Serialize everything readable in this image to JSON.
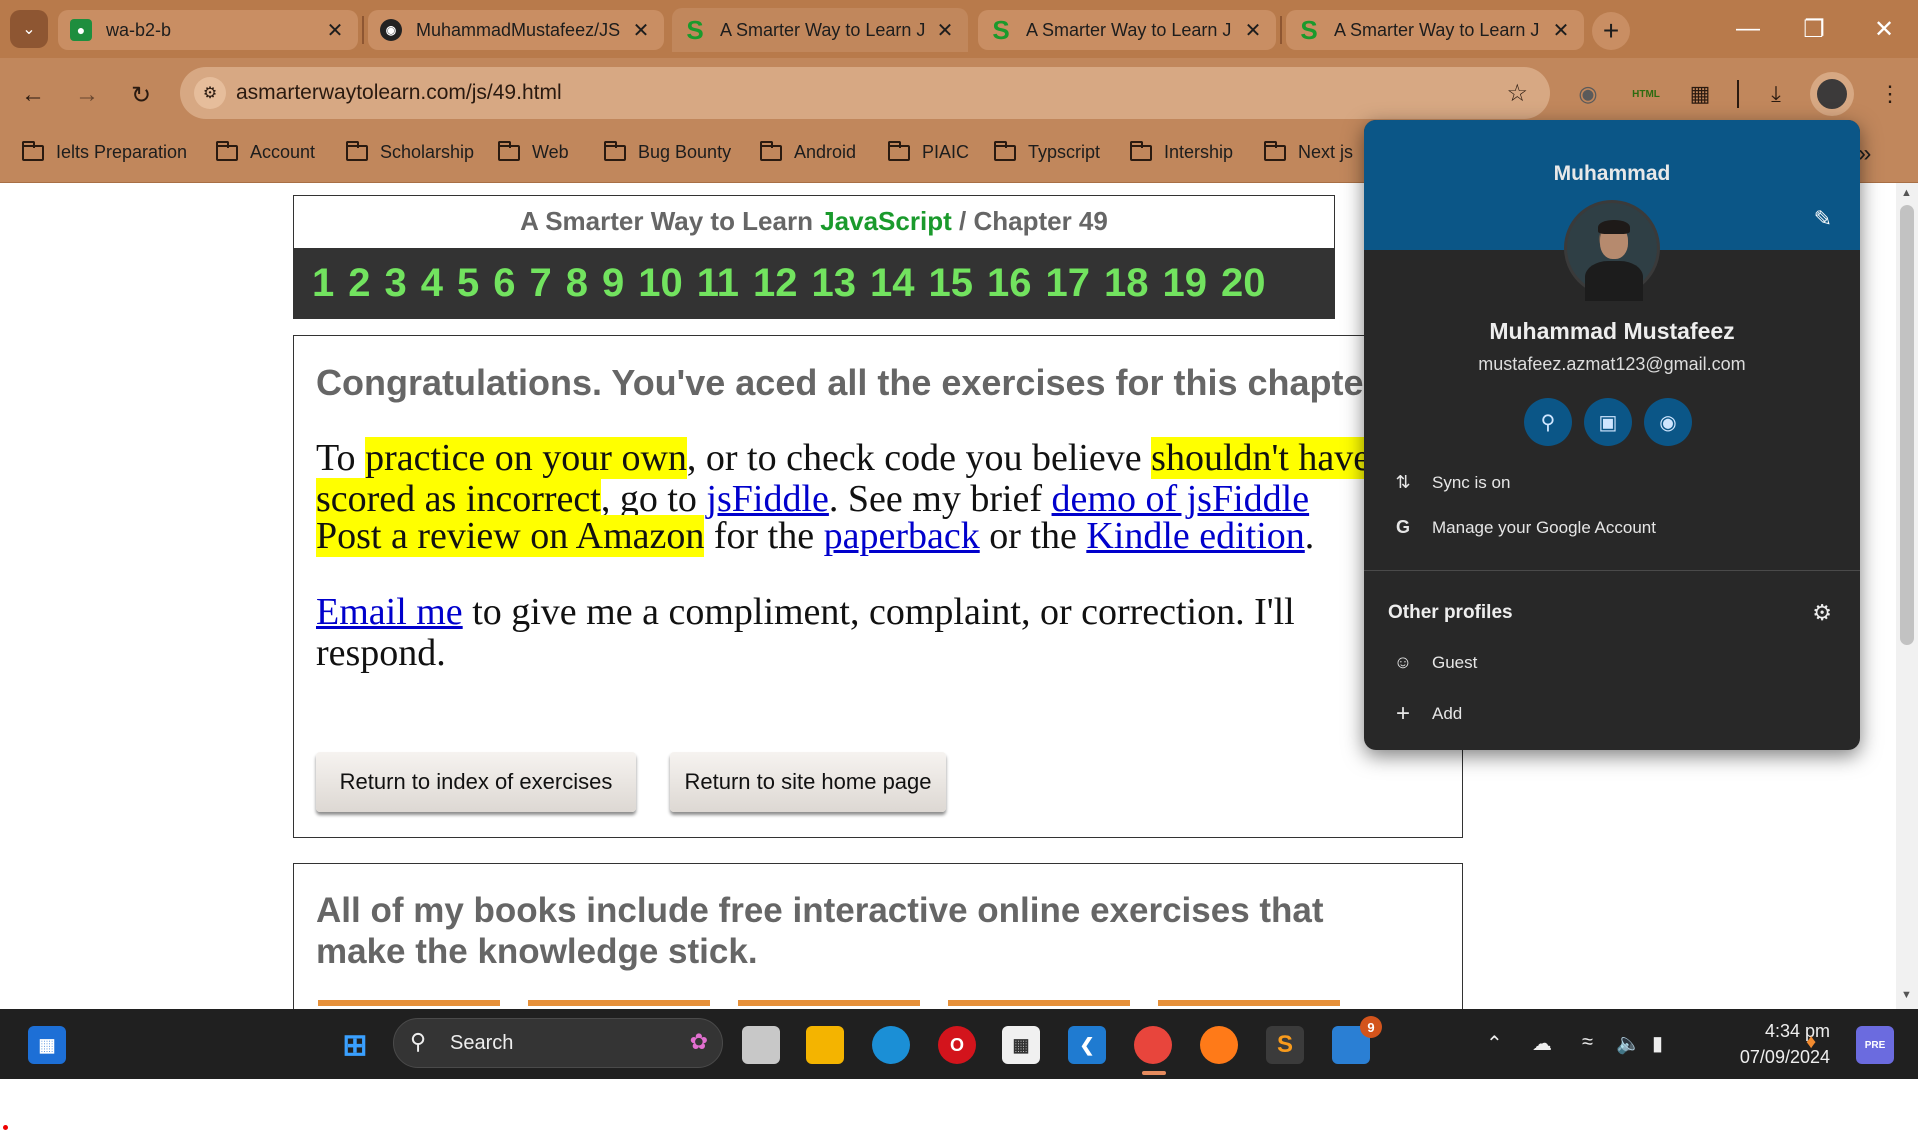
{
  "browser": {
    "tabs": [
      {
        "title": "wa-b2-b",
        "favicon": "classroom-icon",
        "active": false
      },
      {
        "title": "MuhammadMustafeez/JS",
        "favicon": "github-icon",
        "active": false
      },
      {
        "title": "A Smarter Way to Learn J",
        "favicon": "s-logo-icon",
        "active": true
      },
      {
        "title": "A Smarter Way to Learn J",
        "favicon": "s-logo-icon",
        "active": false
      },
      {
        "title": "A Smarter Way to Learn J",
        "favicon": "s-logo-icon",
        "active": false
      }
    ],
    "url": "asmarterwaytolearn.com/js/49.html",
    "bookmarks": [
      "Ielts Preparation",
      "Account",
      "Scholarship",
      "Web",
      "Bug Bounty",
      "Android",
      "PIAIC",
      "Typscript",
      "Intership",
      "Next js"
    ],
    "colors": {
      "frame": "#b87a4b",
      "toolbar": "#c1875c"
    }
  },
  "page": {
    "crumb_prefix": "A Smarter Way to Learn",
    "crumb_js": "JavaScript",
    "crumb_sep": "/",
    "crumb_chapter": "Chapter 49",
    "chapters": [
      "1",
      "2",
      "3",
      "4",
      "5",
      "6",
      "7",
      "8",
      "9",
      "10",
      "11",
      "12",
      "13",
      "14",
      "15",
      "16",
      "17",
      "18",
      "19",
      "20"
    ],
    "congrats": "Congratulations. You've aced all the exercises for this chapter.",
    "p1": {
      "t1": "To ",
      "h1": "practice on your own",
      "t2": ", or to check code you believe ",
      "h2": "shouldn't have been scored as incorrect",
      "t3": ", go to ",
      "l1": "jsFiddle",
      "t4": ". See my brief ",
      "l2": "demo of jsFiddle"
    },
    "p2": {
      "h1": "Post a review on Amazon",
      "t1": " for the ",
      "l1": "paperback",
      "t2": " or the ",
      "l2": "Kindle edition",
      "t3": "."
    },
    "p3": {
      "l1": "Email me",
      "t1": " to give me a compliment, complaint, or correction. I'll respond."
    },
    "btn_index": "Return to index of exercises",
    "btn_home": "Return to site home page",
    "books_title": "All of my books include free interactive online exercises that make the knowledge stick."
  },
  "profile": {
    "header_name": "Muhammad",
    "full_name": "Muhammad Mustafeez",
    "email": "mustafeez.azmat123@gmail.com",
    "sync": "Sync is on",
    "manage": "Manage your Google Account",
    "other_profiles": "Other profiles",
    "guest": "Guest",
    "add": "Add"
  },
  "taskbar": {
    "search": "Search",
    "time": "4:34 pm",
    "date": "07/09/2024",
    "badge": "9"
  }
}
